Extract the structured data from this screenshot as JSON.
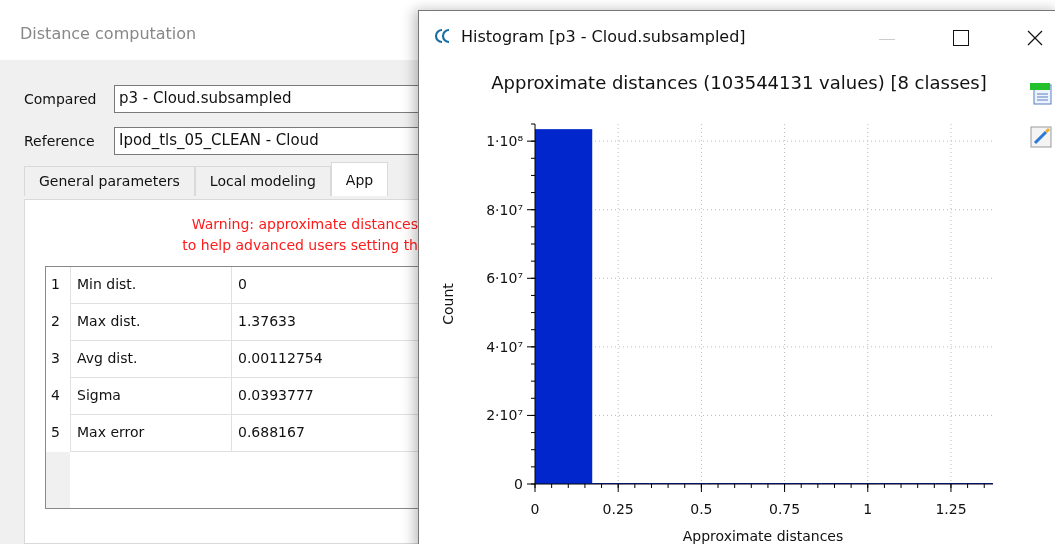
{
  "dialog": {
    "title": "Distance computation",
    "fields": [
      {
        "label": "Compared",
        "value": "p3 - Cloud.subsampled"
      },
      {
        "label": "Reference",
        "value": "Ipod_tls_05_CLEAN - Cloud"
      }
    ],
    "tabs": [
      {
        "label": "General parameters",
        "selected": false
      },
      {
        "label": "Local modeling",
        "selected": false
      },
      {
        "label": "App",
        "selected": true
      }
    ],
    "warning": [
      "Warning: approximate distances",
      "to help advanced users setting th"
    ],
    "table": {
      "rows": [
        [
          "1",
          "Min dist.",
          "0"
        ],
        [
          "2",
          "Max dist.",
          "1.37633"
        ],
        [
          "3",
          "Avg dist.",
          "0.00112754"
        ],
        [
          "4",
          "Sigma",
          "0.0393777"
        ],
        [
          "5",
          "Max error",
          "0.688167"
        ]
      ]
    }
  },
  "histogram": {
    "window": {
      "title": "Histogram [p3 - Cloud.subsampled]"
    },
    "chart_data": {
      "type": "bar",
      "title": "Approximate distances (103544131 values) [8 classes]",
      "xlabel": "Approximate distances",
      "ylabel": "Count",
      "x": [
        0.086,
        0.258,
        0.43,
        0.602,
        0.774,
        0.946,
        1.118,
        1.29
      ],
      "values": [
        103500000,
        0,
        0,
        0,
        0,
        0,
        0,
        0
      ],
      "grid": true,
      "xlim": [
        0,
        1.37633
      ],
      "ylim": [
        0,
        105000000
      ],
      "xticks": [
        0,
        0.25,
        0.5,
        0.75,
        1,
        1.25
      ],
      "yticks": [
        0,
        {
          "value": 20000000,
          "label": "2·10⁷"
        },
        {
          "value": 40000000,
          "label": "4·10⁷"
        },
        {
          "value": 60000000,
          "label": "6·10⁷"
        },
        {
          "value": 80000000,
          "label": "8·10⁷"
        },
        {
          "value": 100000000,
          "label": "1·10⁸"
        }
      ]
    }
  }
}
